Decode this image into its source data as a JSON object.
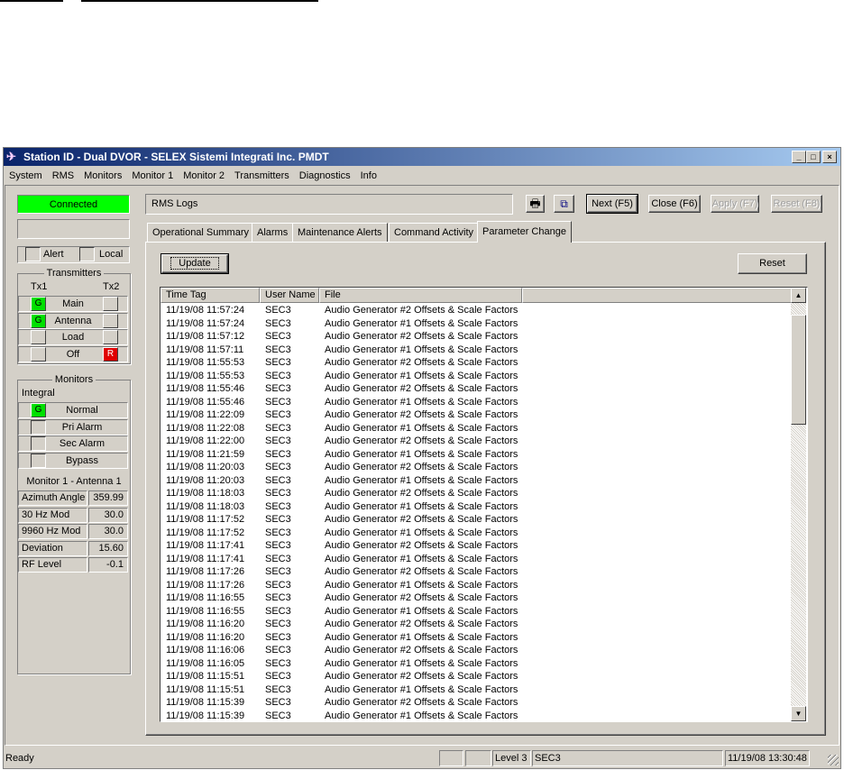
{
  "window": {
    "title": "Station ID - Dual DVOR - SELEX Sistemi Integrati Inc. PMDT"
  },
  "menu": [
    "System",
    "RMS",
    "Monitors",
    "Monitor 1",
    "Monitor 2",
    "Transmitters",
    "Diagnostics",
    "Info"
  ],
  "left": {
    "connection": "Connected",
    "connection_color": "#00ff00",
    "alert": "Alert",
    "local": "Local",
    "transmitters": {
      "title": "Transmitters",
      "tx1": "Tx1",
      "tx2": "Tx2",
      "rows": [
        {
          "label": "Main",
          "tx1": "G",
          "tx2": ""
        },
        {
          "label": "Antenna",
          "tx1": "G",
          "tx2": ""
        },
        {
          "label": "Load",
          "tx1": "",
          "tx2": ""
        },
        {
          "label": "Off",
          "tx1": "",
          "tx2": "R"
        }
      ]
    },
    "monitors": {
      "title": "Monitors",
      "integral": "Integral",
      "rows": [
        {
          "label": "Normal",
          "ind": "G"
        },
        {
          "label": "Pri Alarm",
          "ind": ""
        },
        {
          "label": "Sec Alarm",
          "ind": ""
        },
        {
          "label": "Bypass",
          "ind": ""
        }
      ],
      "subtitle": "Monitor 1 - Antenna 1",
      "readings": [
        {
          "label": "Azimuth Angle",
          "value": "359.99"
        },
        {
          "label": "30 Hz Mod",
          "value": "30.0"
        },
        {
          "label": "9960 Hz Mod",
          "value": "30.0"
        },
        {
          "label": "Deviation",
          "value": "15.60"
        },
        {
          "label": "RF Level",
          "value": "-0.1"
        }
      ]
    }
  },
  "main": {
    "panel_title": "RMS Logs",
    "toolbar": {
      "print_icon": "printer-icon",
      "copy_icon": "copy-icon",
      "next": "Next (F5)",
      "close": "Close (F6)",
      "apply": "Apply (F7)",
      "reset": "Reset (F8)"
    },
    "tabs": [
      "Operational Summary",
      "Alarms",
      "Maintenance Alerts",
      "Command Activity",
      "Parameter Change"
    ],
    "selected_tab": "Parameter Change",
    "update": "Update",
    "reset": "Reset",
    "columns": [
      "Time Tag",
      "User Name",
      "File"
    ],
    "rows": [
      [
        "11/19/08 11:57:24",
        "SEC3",
        "Audio Generator #2 Offsets & Scale Factors"
      ],
      [
        "11/19/08 11:57:24",
        "SEC3",
        "Audio Generator #1 Offsets & Scale Factors"
      ],
      [
        "11/19/08 11:57:12",
        "SEC3",
        "Audio Generator #2 Offsets & Scale Factors"
      ],
      [
        "11/19/08 11:57:11",
        "SEC3",
        "Audio Generator #1 Offsets & Scale Factors"
      ],
      [
        "11/19/08 11:55:53",
        "SEC3",
        "Audio Generator #2 Offsets & Scale Factors"
      ],
      [
        "11/19/08 11:55:53",
        "SEC3",
        "Audio Generator #1 Offsets & Scale Factors"
      ],
      [
        "11/19/08 11:55:46",
        "SEC3",
        "Audio Generator #2 Offsets & Scale Factors"
      ],
      [
        "11/19/08 11:55:46",
        "SEC3",
        "Audio Generator #1 Offsets & Scale Factors"
      ],
      [
        "11/19/08 11:22:09",
        "SEC3",
        "Audio Generator #2 Offsets & Scale Factors"
      ],
      [
        "11/19/08 11:22:08",
        "SEC3",
        "Audio Generator #1 Offsets & Scale Factors"
      ],
      [
        "11/19/08 11:22:00",
        "SEC3",
        "Audio Generator #2 Offsets & Scale Factors"
      ],
      [
        "11/19/08 11:21:59",
        "SEC3",
        "Audio Generator #1 Offsets & Scale Factors"
      ],
      [
        "11/19/08 11:20:03",
        "SEC3",
        "Audio Generator #2 Offsets & Scale Factors"
      ],
      [
        "11/19/08 11:20:03",
        "SEC3",
        "Audio Generator #1 Offsets & Scale Factors"
      ],
      [
        "11/19/08 11:18:03",
        "SEC3",
        "Audio Generator #2 Offsets & Scale Factors"
      ],
      [
        "11/19/08 11:18:03",
        "SEC3",
        "Audio Generator #1 Offsets & Scale Factors"
      ],
      [
        "11/19/08 11:17:52",
        "SEC3",
        "Audio Generator #2 Offsets & Scale Factors"
      ],
      [
        "11/19/08 11:17:52",
        "SEC3",
        "Audio Generator #1 Offsets & Scale Factors"
      ],
      [
        "11/19/08 11:17:41",
        "SEC3",
        "Audio Generator #2 Offsets & Scale Factors"
      ],
      [
        "11/19/08 11:17:41",
        "SEC3",
        "Audio Generator #1 Offsets & Scale Factors"
      ],
      [
        "11/19/08 11:17:26",
        "SEC3",
        "Audio Generator #2 Offsets & Scale Factors"
      ],
      [
        "11/19/08 11:17:26",
        "SEC3",
        "Audio Generator #1 Offsets & Scale Factors"
      ],
      [
        "11/19/08 11:16:55",
        "SEC3",
        "Audio Generator #2 Offsets & Scale Factors"
      ],
      [
        "11/19/08 11:16:55",
        "SEC3",
        "Audio Generator #1 Offsets & Scale Factors"
      ],
      [
        "11/19/08 11:16:20",
        "SEC3",
        "Audio Generator #2 Offsets & Scale Factors"
      ],
      [
        "11/19/08 11:16:20",
        "SEC3",
        "Audio Generator #1 Offsets & Scale Factors"
      ],
      [
        "11/19/08 11:16:06",
        "SEC3",
        "Audio Generator #2 Offsets & Scale Factors"
      ],
      [
        "11/19/08 11:16:05",
        "SEC3",
        "Audio Generator #1 Offsets & Scale Factors"
      ],
      [
        "11/19/08 11:15:51",
        "SEC3",
        "Audio Generator #2 Offsets & Scale Factors"
      ],
      [
        "11/19/08 11:15:51",
        "SEC3",
        "Audio Generator #1 Offsets & Scale Factors"
      ],
      [
        "11/19/08 11:15:39",
        "SEC3",
        "Audio Generator #2 Offsets & Scale Factors"
      ],
      [
        "11/19/08 11:15:39",
        "SEC3",
        "Audio Generator #1 Offsets & Scale Factors"
      ]
    ]
  },
  "status": {
    "text": "Ready",
    "level": "Level 3",
    "user": "SEC3",
    "time": "11/19/08 13:30:48"
  }
}
